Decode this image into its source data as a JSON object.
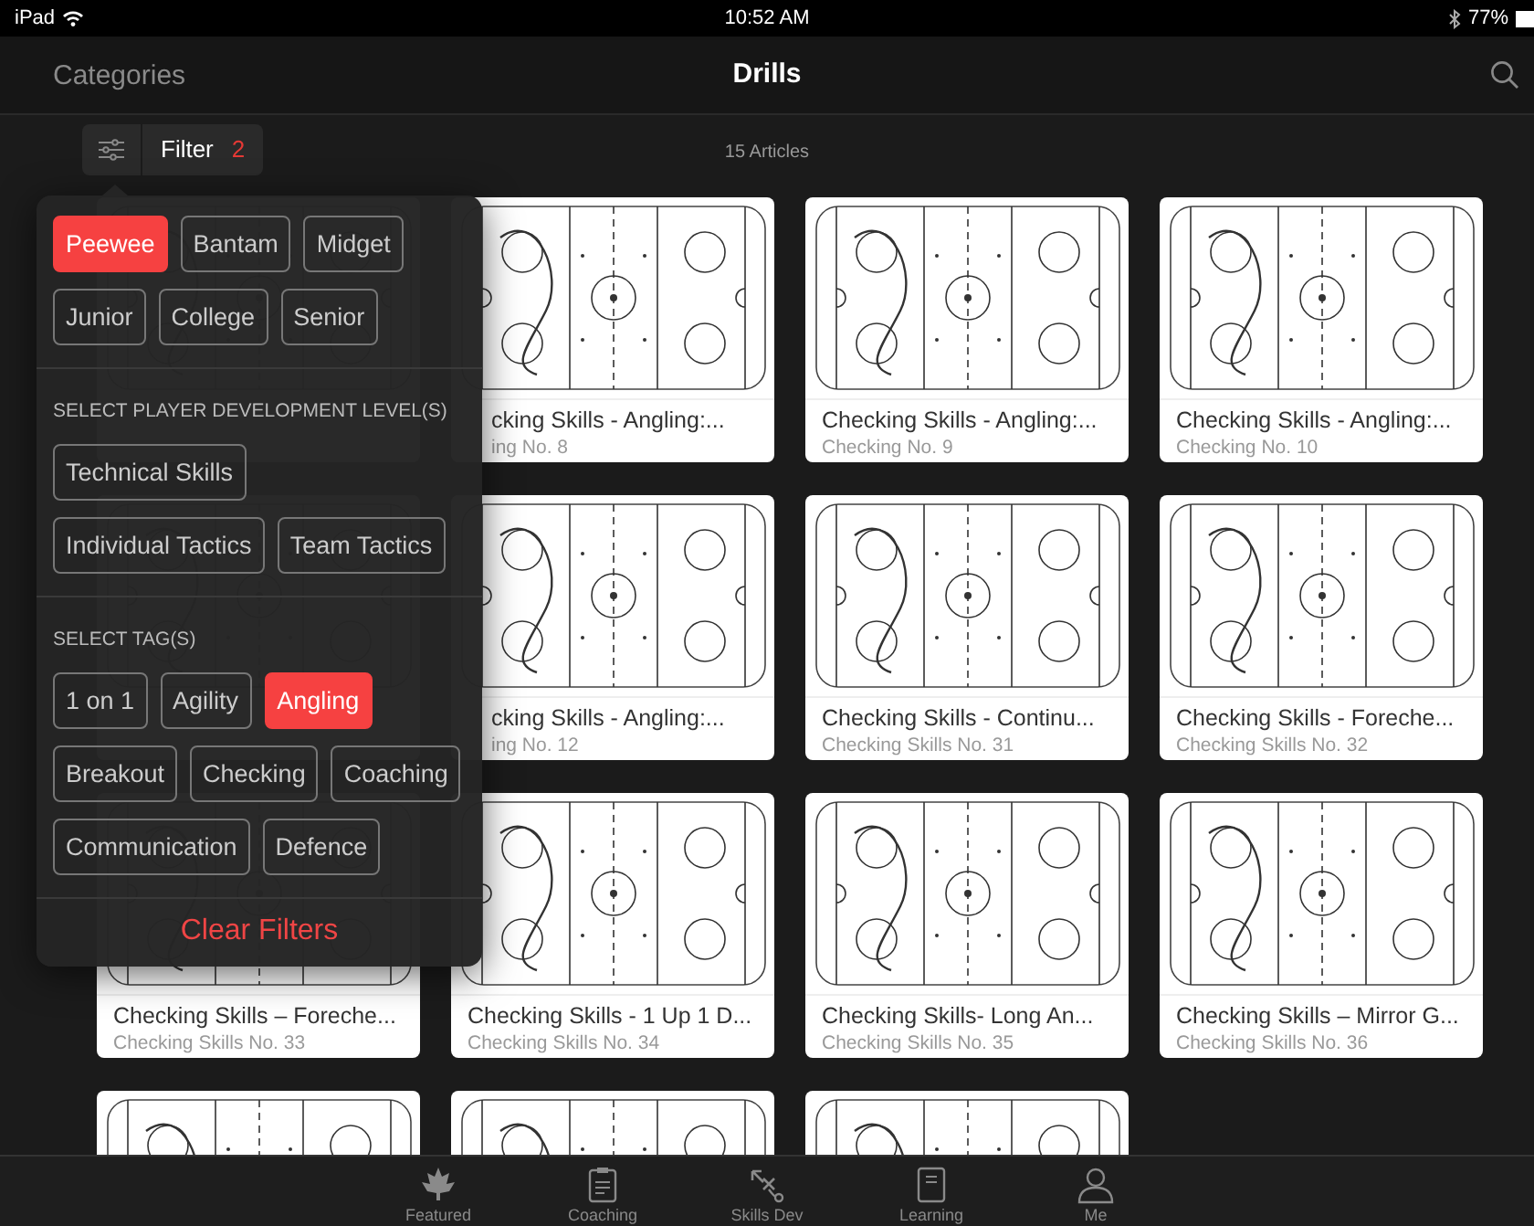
{
  "status_bar": {
    "device": "iPad",
    "time": "10:52 AM",
    "battery": "77%"
  },
  "nav": {
    "back": "Categories",
    "title": "Drills"
  },
  "toolbar": {
    "filter_label": "Filter",
    "filter_count": "2",
    "article_count": "15 Articles"
  },
  "cards": [
    {
      "kind": "covered"
    },
    {
      "kind": "partial",
      "title": "cking Skills - Angling:...",
      "subtitle": "ing No. 8"
    },
    {
      "kind": "full",
      "title": "Checking Skills - Angling:...",
      "subtitle": "Checking No. 9"
    },
    {
      "kind": "full",
      "title": "Checking Skills - Angling:...",
      "subtitle": "Checking No. 10"
    },
    {
      "kind": "covered"
    },
    {
      "kind": "partial",
      "title": "cking Skills - Angling:...",
      "subtitle": "ing No. 12"
    },
    {
      "kind": "full",
      "title": "Checking Skills - Continu...",
      "subtitle": "Checking Skills No. 31"
    },
    {
      "kind": "full",
      "title": "Checking Skills - Foreche...",
      "subtitle": "Checking Skills No. 32"
    },
    {
      "kind": "full",
      "title": "Checking Skills – Foreche...",
      "subtitle": "Checking Skills No. 33"
    },
    {
      "kind": "full",
      "title": "Checking Skills - 1 Up 1 D...",
      "subtitle": "Checking Skills No. 34"
    },
    {
      "kind": "full",
      "title": "Checking Skills- Long An...",
      "subtitle": "Checking Skills No. 35"
    },
    {
      "kind": "full",
      "title": "Checking Skills – Mirror G...",
      "subtitle": "Checking Skills No. 36"
    },
    {
      "kind": "cut"
    },
    {
      "kind": "cut"
    },
    {
      "kind": "cut"
    }
  ],
  "filter_popover": {
    "groups": [
      {
        "chips": [
          {
            "label": "Peewee",
            "selected": true
          },
          {
            "label": "Bantam",
            "selected": false
          },
          {
            "label": "Midget",
            "selected": false
          },
          {
            "label": "Junior",
            "selected": false
          },
          {
            "label": "College",
            "selected": false
          },
          {
            "label": "Senior",
            "selected": false
          }
        ]
      },
      {
        "heading": "SELECT PLAYER DEVELOPMENT LEVEL(S)",
        "chips": [
          {
            "label": "Technical Skills",
            "selected": false
          },
          {
            "label": "Individual Tactics",
            "selected": false
          },
          {
            "label": "Team Tactics",
            "selected": false
          }
        ]
      },
      {
        "heading": "SELECT TAG(S)",
        "chips": [
          {
            "label": "1 on 1",
            "selected": false
          },
          {
            "label": "Agility",
            "selected": false
          },
          {
            "label": "Angling",
            "selected": true
          },
          {
            "label": "Breakout",
            "selected": false
          },
          {
            "label": "Checking",
            "selected": false
          },
          {
            "label": "Coaching",
            "selected": false
          },
          {
            "label": "Communication",
            "selected": false
          },
          {
            "label": "Defence",
            "selected": false
          }
        ]
      }
    ],
    "clear": "Clear Filters"
  },
  "tab_bar": [
    {
      "kind": "leaf",
      "label": "Featured",
      "selected": false
    },
    {
      "kind": "clipboard",
      "label": "Coaching",
      "selected": false
    },
    {
      "kind": "play",
      "label": "Skills Dev",
      "selected": false
    },
    {
      "kind": "notebook",
      "label": "Learning",
      "selected": false
    },
    {
      "kind": "person",
      "label": "Me",
      "selected": false
    }
  ]
}
